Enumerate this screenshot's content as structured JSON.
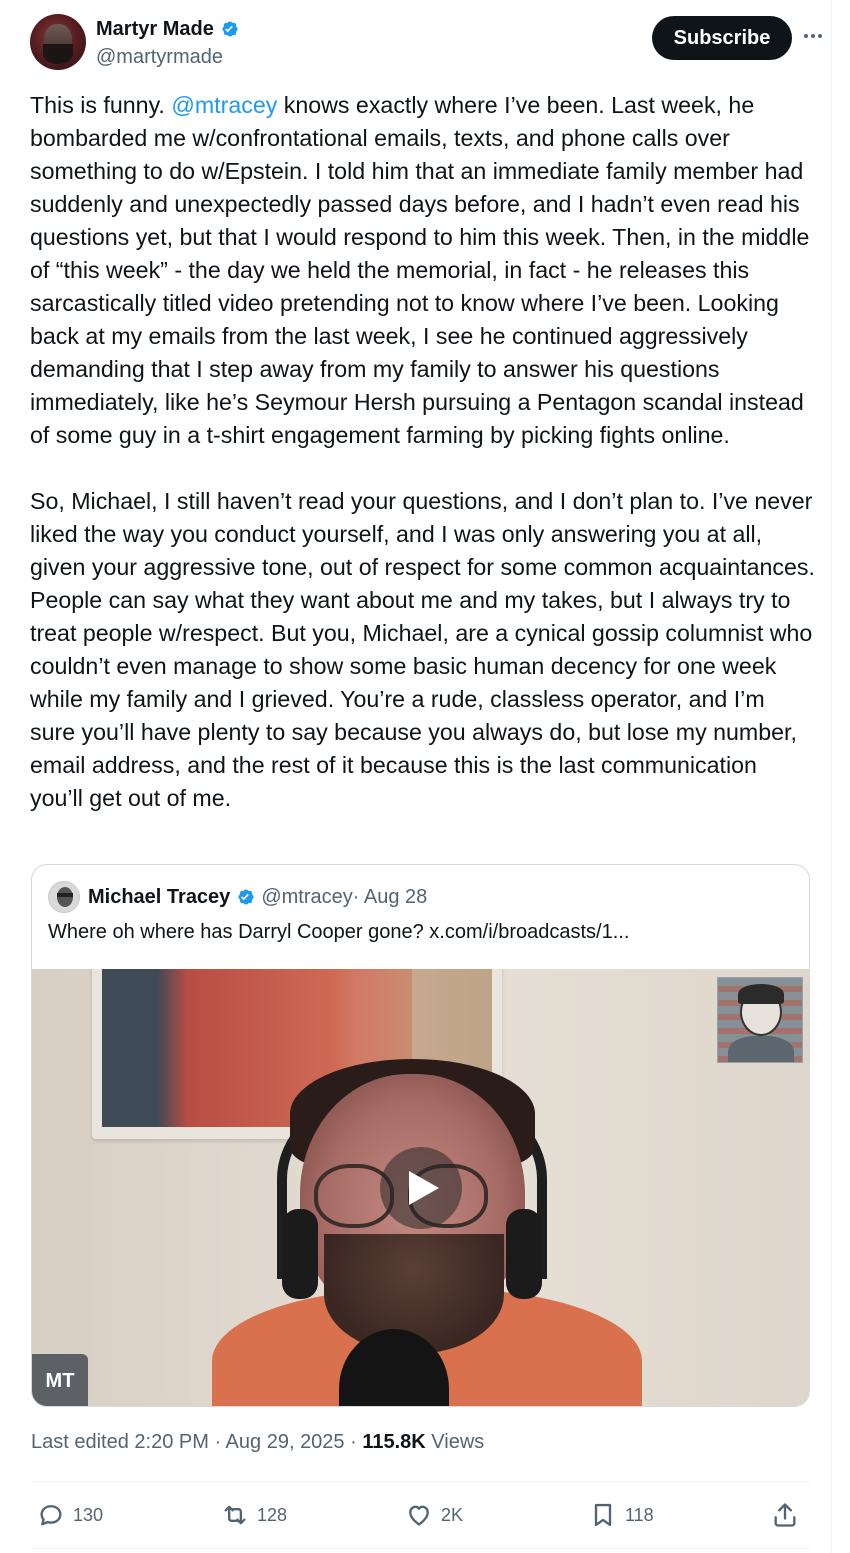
{
  "author": {
    "display_name": "Martyr Made",
    "handle": "@martyrmade",
    "subscribe_label": "Subscribe"
  },
  "tweet": {
    "para1_before_mention": "This is funny. ",
    "mention": "@mtracey",
    "para1_after_mention": " knows exactly where I’ve been. Last week, he bombarded me w/confrontational emails, texts, and phone calls over something to do w/Epstein. I told him that an immediate family member had suddenly and unexpectedly passed days before, and I hadn’t even read his questions yet, but that I would respond to him this week. Then, in the middle of “this week” - the day we held the memorial, in fact - he releases this sarcastically titled video pretending not to know where I’ve been. Looking back at my emails from the last week, I see he continued aggressively demanding that I step away from my family to answer his questions immediately, like he’s Seymour Hersh pursuing a Pentagon scandal instead of some guy in a t-shirt engagement farming by picking fights online.",
    "para2": "So, Michael, I still haven’t read your questions, and I don’t plan to. I’ve never liked the way you conduct yourself, and I was only answering you at all, given your aggressive tone, out of respect for some common acquaintances. People can say what they want about me and my takes, but I always try to treat people w/respect. But you, Michael, are a cynical gossip columnist who couldn’t even manage to show some basic human decency for one week while my family and I grieved. You’re a rude, classless operator, and I’m sure you’ll have plenty to say because you always do, but lose my number, email address, and the rest of it because this is the last communication you’ll get out of me."
  },
  "quoted": {
    "display_name": "Michael Tracey",
    "handle": "@mtracey",
    "date": " · Aug 28",
    "text": "Where oh where has Darryl Cooper gone? x.com/i/broadcasts/1...",
    "badge": "MT"
  },
  "meta": {
    "edited": "Last edited 2:20 PM · Aug 29, 2025 · ",
    "views_count": "115.8K",
    "views_label": " Views"
  },
  "actions": {
    "replies": "130",
    "reposts": "128",
    "likes": "2K",
    "bookmarks": "118"
  },
  "colors": {
    "link": "#1d9bf0",
    "verified": "#1d9bf0",
    "text": "#0f1419",
    "secondary": "#536471"
  }
}
